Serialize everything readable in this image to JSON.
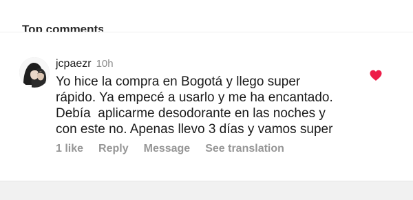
{
  "section": {
    "header_label": "Top comments"
  },
  "comment": {
    "username": "jcpaezr",
    "time": "10h",
    "lines": [
      "Yo hice la compra en Bogotá y llego super",
      "rápido. Ya empecé a usarlo y me ha encantado.",
      "Debía  aplicarme desodorante en las noches y",
      "con este no. Apenas llevo 3 días y vamos super"
    ],
    "liked": true,
    "actions": {
      "likes": "1 like",
      "reply": "Reply",
      "message": "Message",
      "translation": "See translation"
    }
  },
  "colors": {
    "heart": "#ed1d49",
    "text": "#1a1a1a",
    "muted": "#8e8e8e"
  },
  "icons": {
    "like": "heart-icon",
    "avatar": "user-avatar"
  }
}
